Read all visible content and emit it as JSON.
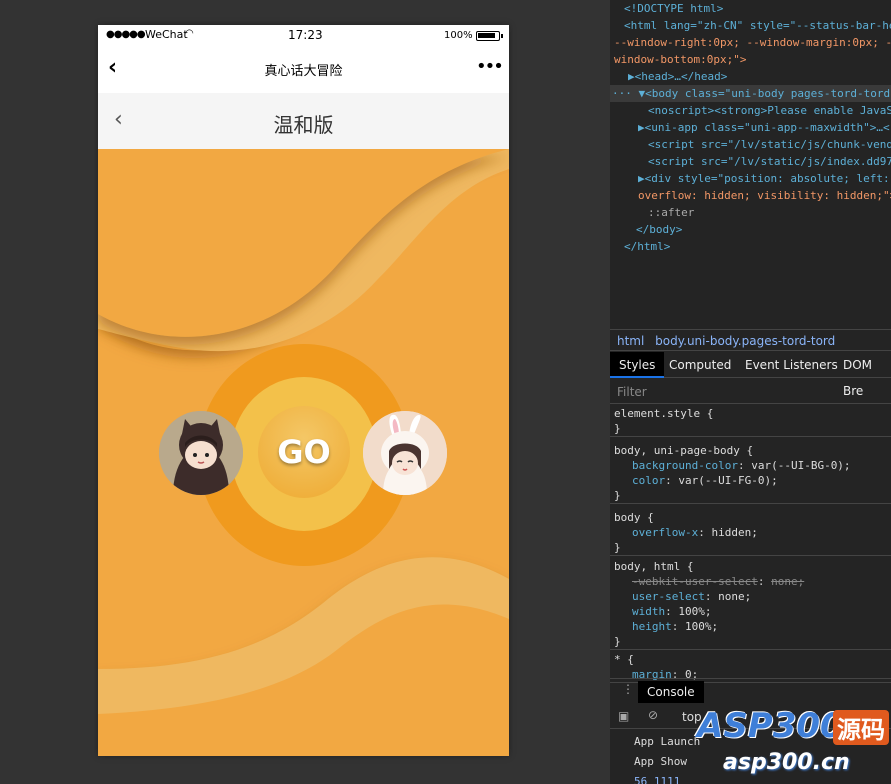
{
  "phone": {
    "status": {
      "carrier": "WeChat",
      "time": "17:23",
      "battery": "100%"
    },
    "nav": {
      "back": "‹",
      "title": "真心话大冒险",
      "more": "•••"
    },
    "sub": {
      "back": "‹",
      "title": "温和版"
    },
    "go_label": "GO"
  },
  "devtools": {
    "dom": [
      {
        "t": "<!DOCTYPE html>"
      },
      {
        "t": "<html lang=\"zh-CN\" style=\"--status-bar-he"
      },
      {
        "t": "--window-right:0px; --window-margin:0px; -"
      },
      {
        "t": "window-bottom:0px;\">"
      },
      {
        "t": "▶<head>…</head>"
      },
      {
        "t": "··· ▼<body class=\"uni-body pages-tord-tord\">"
      },
      {
        "t": "<noscript><strong>Please enable JavaS"
      },
      {
        "t": "▶<uni-app class=\"uni-app--maxwidth\">…<"
      },
      {
        "t": "<script src=\"/lv/static/js/chunk-vend"
      },
      {
        "t": "<script src=\"/lv/static/js/index.dd97"
      },
      {
        "t": "▶<div style=\"position: absolute; left:"
      },
      {
        "t": "overflow: hidden; visibility: hidden;\">"
      },
      {
        "t": "::after"
      },
      {
        "t": "</body>"
      },
      {
        "t": "</html>"
      }
    ],
    "breadcrumb": [
      "html",
      "body.uni-body.pages-tord-tord"
    ],
    "tabs": [
      "Styles",
      "Computed",
      "Event Listeners",
      "DOM Bre"
    ],
    "filter_placeholder": "Filter",
    "rules": [
      {
        "sel": "element.style {",
        "props": [],
        "end": "}"
      },
      {
        "sel": "body, uni-page-body {",
        "props": [
          [
            "background-color",
            "var(--UI-BG-0);"
          ],
          [
            "color",
            "var(--UI-FG-0);"
          ]
        ],
        "end": "}"
      },
      {
        "sel": "body {",
        "props": [
          [
            "overflow-x",
            "hidden;"
          ]
        ],
        "end": "}"
      },
      {
        "sel": "body, html {",
        "props": [
          [
            "-webkit-user-select",
            "none;"
          ],
          [
            "user-select",
            "none;"
          ],
          [
            "width",
            "100%;"
          ],
          [
            "height",
            "100%;"
          ]
        ],
        "end": "}"
      },
      {
        "sel": "* {",
        "props": [
          [
            "margin",
            "0;"
          ]
        ],
        "end": ""
      }
    ],
    "console_tab": "Console",
    "context": "top",
    "logs": [
      "App Launch",
      "App Show",
      "56 1111"
    ]
  },
  "watermark": {
    "brand": "ASP300",
    "tag": "源码",
    "url": "asp300.cn"
  }
}
